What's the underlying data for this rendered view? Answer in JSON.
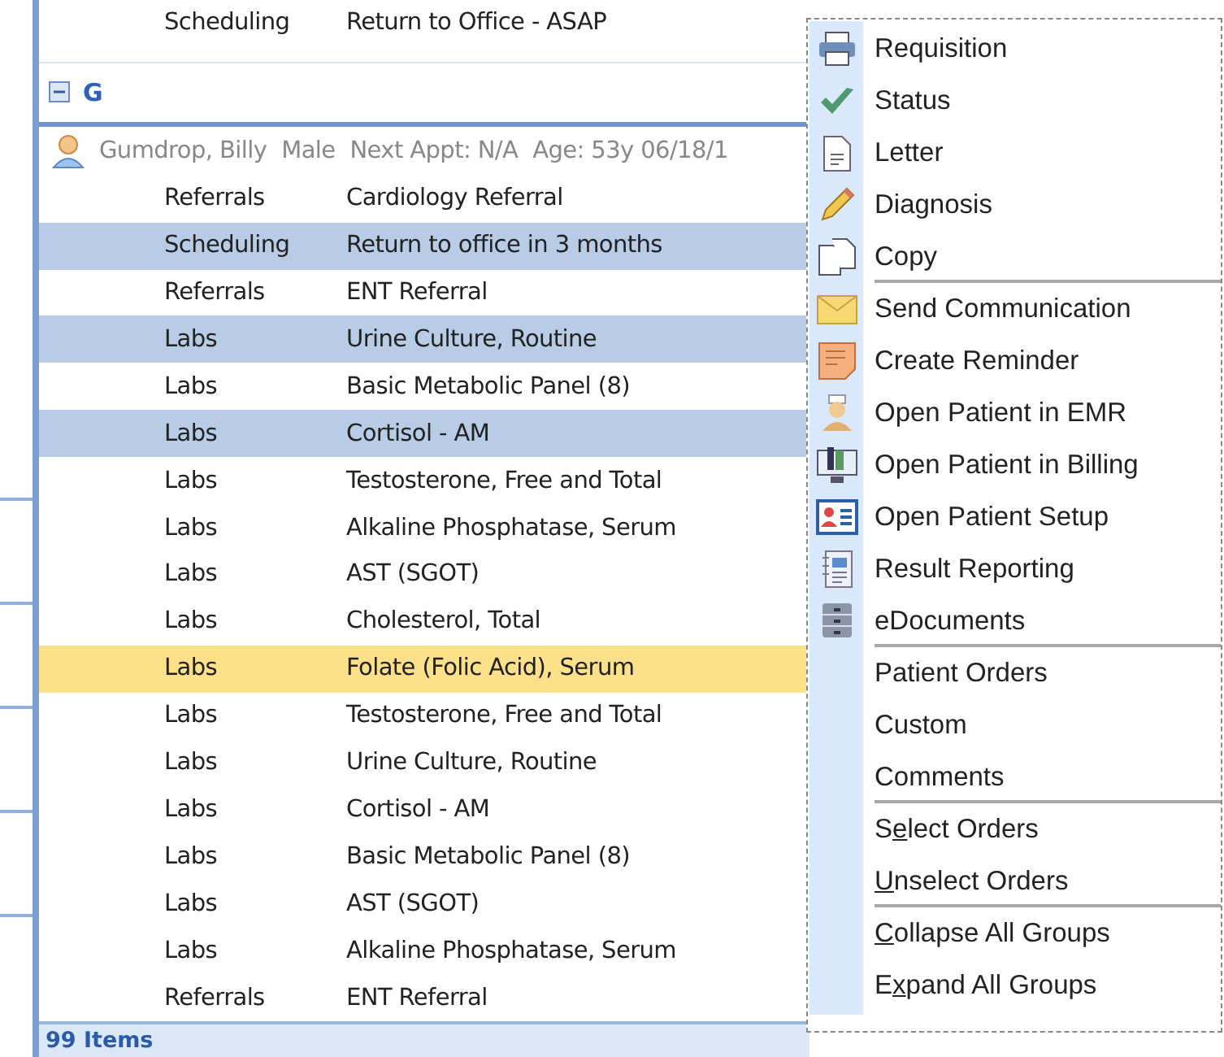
{
  "top_row": {
    "category": "Scheduling",
    "description": "Return to Office - ASAP"
  },
  "group": {
    "letter": "G",
    "expanded": true
  },
  "patient": {
    "name": "Gumdrop, Billy",
    "sex": "Male",
    "next_appt": "Next Appt: N/A",
    "age": "Age: 53y 06/18/1"
  },
  "rows": [
    {
      "category": "Referrals",
      "description": "Cardiology Referral",
      "selected": false,
      "hot": false
    },
    {
      "category": "Scheduling",
      "description": "Return to office in 3 months",
      "selected": true,
      "hot": false
    },
    {
      "category": "Referrals",
      "description": "ENT Referral",
      "selected": false,
      "hot": false
    },
    {
      "category": "Labs",
      "description": "Urine Culture, Routine",
      "selected": true,
      "hot": false
    },
    {
      "category": "Labs",
      "description": "Basic Metabolic Panel (8)",
      "selected": false,
      "hot": false
    },
    {
      "category": "Labs",
      "description": "Cortisol - AM",
      "selected": true,
      "hot": false
    },
    {
      "category": "Labs",
      "description": "Testosterone, Free and Total",
      "selected": false,
      "hot": false
    },
    {
      "category": "Labs",
      "description": "Alkaline Phosphatase, Serum",
      "selected": false,
      "hot": false
    },
    {
      "category": "Labs",
      "description": "AST (SGOT)",
      "selected": false,
      "hot": false
    },
    {
      "category": "Labs",
      "description": "Cholesterol, Total",
      "selected": false,
      "hot": false
    },
    {
      "category": "Labs",
      "description": "Folate (Folic Acid), Serum",
      "selected": false,
      "hot": true
    },
    {
      "category": "Labs",
      "description": "Testosterone, Free and Total",
      "selected": false,
      "hot": false
    },
    {
      "category": "Labs",
      "description": "Urine Culture, Routine",
      "selected": false,
      "hot": false
    },
    {
      "category": "Labs",
      "description": "Cortisol - AM",
      "selected": false,
      "hot": false
    },
    {
      "category": "Labs",
      "description": "Basic Metabolic Panel (8)",
      "selected": false,
      "hot": false
    },
    {
      "category": "Labs",
      "description": "AST (SGOT)",
      "selected": false,
      "hot": false
    },
    {
      "category": "Labs",
      "description": "Alkaline Phosphatase, Serum",
      "selected": false,
      "hot": false
    },
    {
      "category": "Referrals",
      "description": "ENT Referral",
      "selected": false,
      "hot": false
    }
  ],
  "status_bar": "99 Items",
  "context_menu": [
    {
      "label": "Requisition",
      "separator_after": false
    },
    {
      "label": "Status",
      "separator_after": false
    },
    {
      "label": "Letter",
      "separator_after": false
    },
    {
      "label": "Diagnosis",
      "separator_after": false
    },
    {
      "label": "Copy",
      "separator_after": true
    },
    {
      "label": "Send Communication",
      "separator_after": false
    },
    {
      "label": "Create Reminder",
      "separator_after": false
    },
    {
      "label": "Open Patient in EMR",
      "separator_after": false
    },
    {
      "label": "Open Patient in Billing",
      "separator_after": false
    },
    {
      "label": "Open Patient Setup",
      "separator_after": false
    },
    {
      "label": "Result Reporting",
      "separator_after": false
    },
    {
      "label": "eDocuments",
      "separator_after": true
    },
    {
      "label": "Patient Orders",
      "separator_after": false
    },
    {
      "label": "Custom",
      "separator_after": false
    },
    {
      "label": "Comments",
      "separator_after": true
    },
    {
      "label": "S",
      "access_key": "e",
      "label_rest": "lect Orders",
      "separator_after": false
    },
    {
      "access_key": "U",
      "label_rest": "nselect Orders",
      "separator_after": true
    },
    {
      "access_key": "C",
      "label_rest": "ollapse All Groups",
      "separator_after": false
    },
    {
      "label": "E",
      "access_key": "x",
      "label_rest": "pand All Groups",
      "separator_after": false
    }
  ]
}
